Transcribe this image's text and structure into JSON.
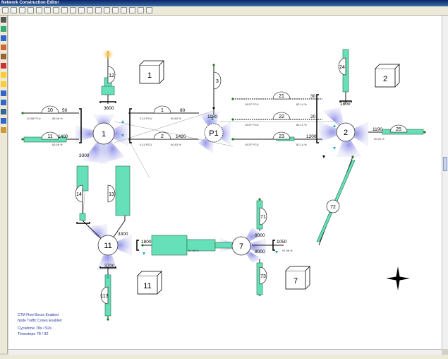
{
  "window": {
    "title": "Network Construction Editor"
  },
  "toolbar": {
    "buttons": [
      "new-icon",
      "open-icon",
      "save-icon",
      "zoom-in-icon",
      "zoom-out-icon",
      "fit-icon",
      "pan-icon",
      "node-icon",
      "link-icon",
      "signal-icon",
      "detector-icon",
      "flag-icon",
      "chart-icon",
      "run-icon",
      "stop-icon",
      "grid-icon",
      "pencil-icon",
      "print-icon"
    ]
  },
  "left_tools": [
    "select-icon",
    "node-tool-icon",
    "link-tool-icon",
    "lane-tool-icon",
    "signal-tool-icon",
    "zone-tool-icon",
    "warning-icon",
    "info-icon",
    "curve-tool-icon",
    "measure-tool-icon",
    "label-tool-icon",
    "text-tool-icon",
    "image-tool-icon"
  ],
  "nodes": [
    {
      "id": "n1",
      "label": "1"
    },
    {
      "id": "n2",
      "label": "2"
    },
    {
      "id": "np1",
      "label": "P1"
    },
    {
      "id": "n11",
      "label": "11"
    },
    {
      "id": "n7",
      "label": "7"
    }
  ],
  "zones": [
    {
      "id": "z1",
      "label": "1"
    },
    {
      "id": "z2",
      "label": "2"
    },
    {
      "id": "z11",
      "label": "11"
    },
    {
      "id": "z7",
      "label": "7"
    }
  ],
  "links": [
    {
      "id": "10",
      "cap": "50",
      "pct": "83.48 %",
      "pcu": "20.88 PCU"
    },
    {
      "id": "11",
      "cap": "1400",
      "pct": "83.48 %"
    },
    {
      "id": "1",
      "cap": "80",
      "pct": "40.83 %",
      "pcu": "0.14 PCU"
    },
    {
      "id": "2",
      "cap": "1420",
      "pct": "40.83 %",
      "pcu": "0.14 PCU"
    },
    {
      "id": "21",
      "cap": "30",
      "pct": "82.14 %",
      "pcu": "16.57 PCU"
    },
    {
      "id": "22",
      "cap": "20",
      "pct": "82.14 %",
      "pcu": "16.57 PCU"
    },
    {
      "id": "23",
      "cap": "1200",
      "pct": "82.14 %",
      "pcu": "16.57 PCU"
    },
    {
      "id": "25",
      "cap": "1190",
      "pct": "90.00 %"
    },
    {
      "id": "24",
      "cap": "1800",
      "pct": "95.58 %"
    },
    {
      "id": "12",
      "cap": "3600"
    },
    {
      "id": "3",
      "cap": "1180",
      "pct": "61.60 %"
    },
    {
      "id": "13",
      "cap": "360",
      "pct": "90.78 %"
    },
    {
      "id": "14",
      "cap": "3300"
    },
    {
      "id": "72",
      "cap": "1050",
      "pct": "97.98 %"
    },
    {
      "id": "71",
      "cap": "8000"
    },
    {
      "id": "73",
      "cap": "8000"
    },
    {
      "id": "113",
      "cap": "3700",
      "pct": "91.88 %"
    }
  ],
  "misc": {
    "p1_cap": "3600",
    "n1_cap": "3400",
    "n2_cap": "3600",
    "n11_cap": "3300",
    "n7_cap": "1050",
    "n11_in": "1800"
  },
  "info_panel": {
    "line1": "CTM Flow Boxes Enabled",
    "line2": "Node Traffic Cones Enabled",
    "cycletime": "Cycletime  78s / 92s",
    "timesteps": "Timesteps  78 / 92"
  },
  "colors": {
    "lane": "#66e0b8",
    "cone": "#9a9ae8",
    "link": "#1a1a1a",
    "info": "#2a3a9a"
  }
}
